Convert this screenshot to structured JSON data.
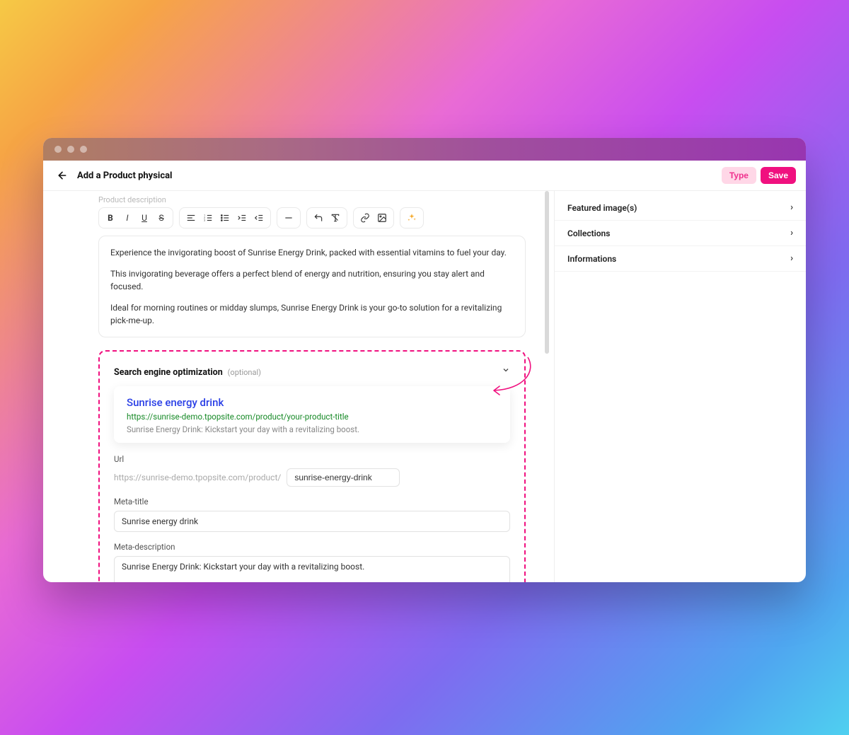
{
  "header": {
    "title": "Add a Product physical",
    "type_button": "Type",
    "save_button": "Save"
  },
  "editor": {
    "section_label": "Product description",
    "paragraphs": [
      "Experience the invigorating boost of Sunrise Energy Drink, packed with essential vitamins to fuel your day.",
      "This invigorating beverage offers a perfect blend of energy and nutrition, ensuring you stay alert and focused.",
      "Ideal for morning routines or midday slumps, Sunrise Energy Drink is your go-to solution for a revitalizing pick-me-up."
    ]
  },
  "seo": {
    "section_title": "Search engine optimization",
    "optional_label": "(optional)",
    "preview": {
      "title": "Sunrise energy drink",
      "url": "https://sunrise-demo.tpopsite.com/product/your-product-title",
      "description": "Sunrise Energy Drink: Kickstart your day with a revitalizing boost."
    },
    "fields": {
      "url_label": "Url",
      "url_prefix": "https://sunrise-demo.tpopsite.com/product/",
      "slug_value": "sunrise-energy-drink",
      "meta_title_label": "Meta-title",
      "meta_title_value": "Sunrise energy drink",
      "meta_desc_label": "Meta-description",
      "meta_desc_value": "Sunrise Energy Drink: Kickstart your day with a revitalizing boost."
    }
  },
  "sidebar": {
    "items": [
      {
        "label": "Featured image(s)"
      },
      {
        "label": "Collections"
      },
      {
        "label": "Informations"
      }
    ]
  }
}
